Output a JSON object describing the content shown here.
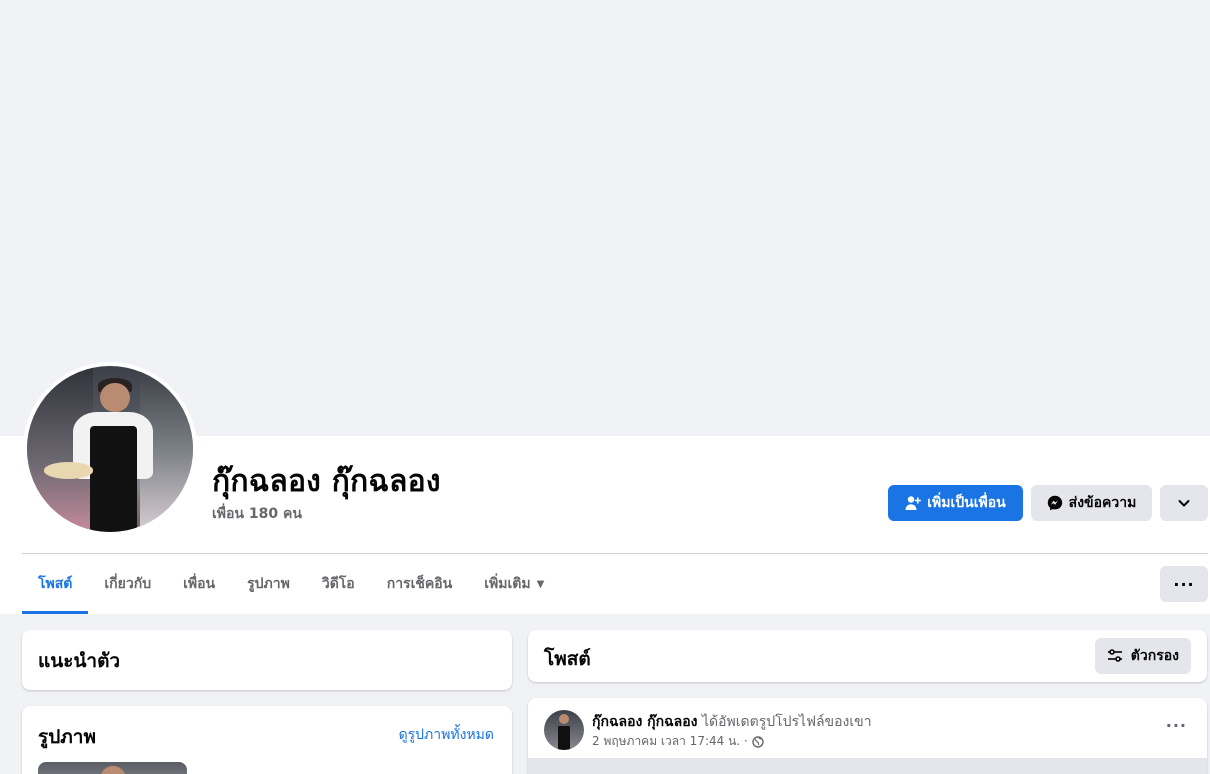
{
  "profile": {
    "name": "กุ๊กฉลอง กุ๊กฉลอง",
    "friends_label": "เพื่อน 180 คน"
  },
  "actions": {
    "add_friend": "เพิ่มเป็นเพื่อน",
    "message": "ส่งข้อความ",
    "more_icon": "chevron-down-icon"
  },
  "tabs": [
    {
      "label": "โพสต์",
      "active": true
    },
    {
      "label": "เกี่ยวกับ",
      "active": false
    },
    {
      "label": "เพื่อน",
      "active": false
    },
    {
      "label": "รูปภาพ",
      "active": false
    },
    {
      "label": "วิดีโอ",
      "active": false
    },
    {
      "label": "การเช็คอิน",
      "active": false
    },
    {
      "label": "เพิ่มเติม",
      "active": false
    }
  ],
  "tabs_more_label": "···",
  "intro": {
    "title": "แนะนำตัว"
  },
  "photos": {
    "title": "รูปภาพ",
    "see_all": "ดูรูปภาพทั้งหมด"
  },
  "posts": {
    "title": "โพสต์",
    "filter": "ตัวกรอง"
  },
  "post": {
    "author": "กุ๊กฉลอง กุ๊กฉลอง",
    "action": "ได้อัพเดตรูปโปรไฟล์ของเขา",
    "timestamp": "2 พฤษภาคม เวลา 17:44 น. ·",
    "more": "···"
  },
  "colors": {
    "primary": "#1b74e4",
    "secondary_bg": "#e4e6eb",
    "page_bg": "#f0f2f5",
    "muted_text": "#65676b"
  }
}
